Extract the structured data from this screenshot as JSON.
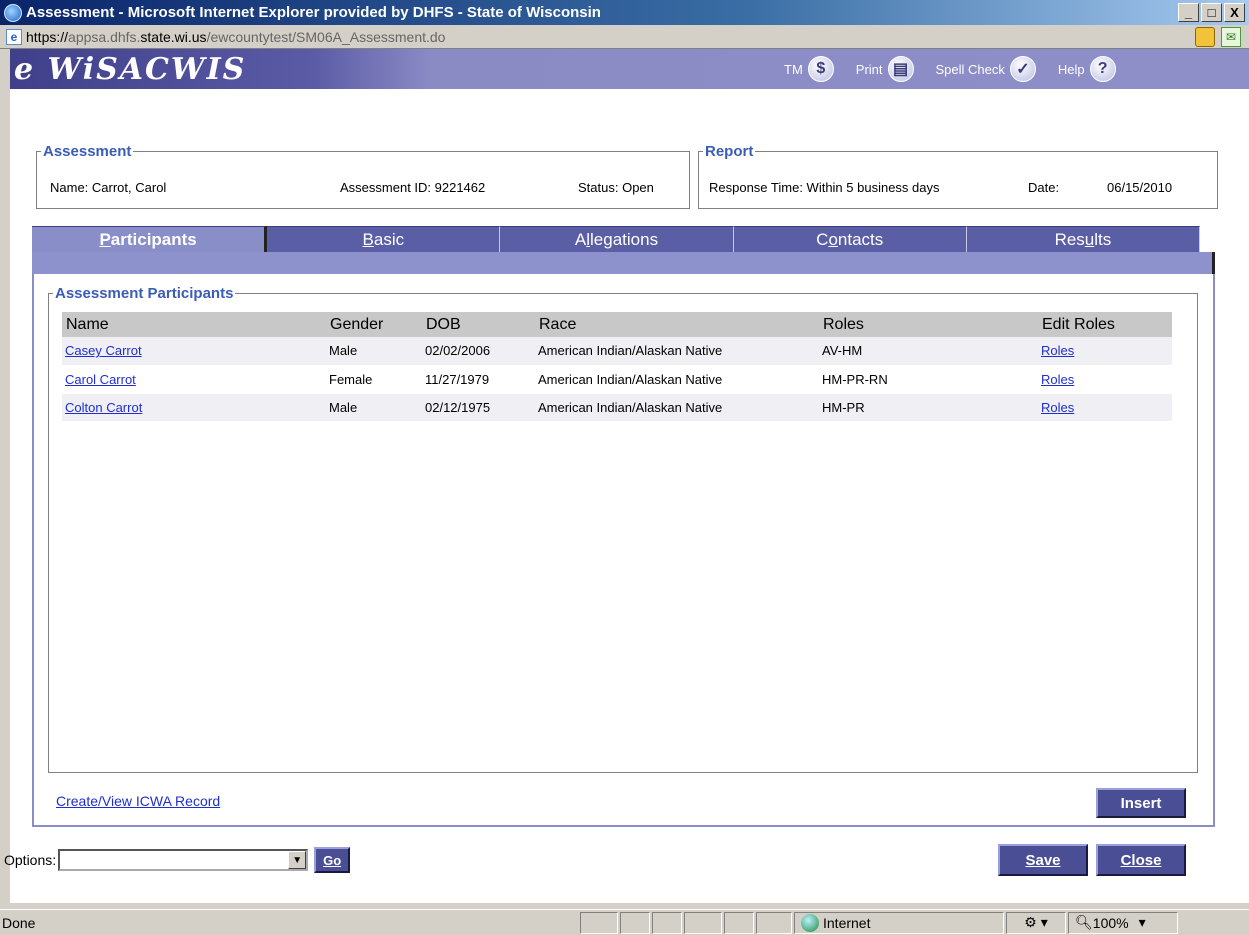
{
  "window": {
    "title": "Assessment - Microsoft Internet Explorer provided by DHFS - State of Wisconsin",
    "minimize": "_",
    "maximize": "□",
    "close": "X"
  },
  "address": {
    "url_scheme": "https://",
    "url_sub": "appsa.dhfs.",
    "url_host": "state.wi.us",
    "url_path": "/ewcountytest/SM06A_Assessment.do"
  },
  "app": {
    "brand": "e WiSACWIS",
    "tools": [
      {
        "label": "TM",
        "icon": "tm-globe-icon",
        "glyph": "$"
      },
      {
        "label": "Print",
        "icon": "print-icon",
        "glyph": "▤"
      },
      {
        "label": "Spell Check",
        "icon": "spell-check-icon",
        "glyph": "✓"
      },
      {
        "label": "Help",
        "icon": "help-icon",
        "glyph": "?"
      }
    ]
  },
  "assessment": {
    "legend": "Assessment",
    "name": "Name: Carrot, Carol",
    "id": "Assessment ID: 9221462",
    "status": "Status:  Open"
  },
  "report": {
    "legend": "Report",
    "response_time": "Response Time:  Within 5 business days",
    "date_label": "Date:",
    "date_value": "06/15/2010"
  },
  "tabs": [
    {
      "first": "P",
      "rest": "articipants",
      "active": true
    },
    {
      "first": "B",
      "rest": "asic",
      "active": false
    },
    {
      "pre": "A",
      "first": "l",
      "rest": "legations",
      "active": false
    },
    {
      "pre": "C",
      "first": "o",
      "rest": "ntacts",
      "active": false
    },
    {
      "pre": "Res",
      "first": "u",
      "rest": "lts",
      "active": false
    }
  ],
  "participants": {
    "legend": "Assessment Participants",
    "columns": [
      "Name",
      "Gender",
      "DOB",
      "Race",
      "Roles",
      "Edit Roles"
    ],
    "rows": [
      {
        "name": "Casey Carrot",
        "gender": "Male",
        "dob": "02/02/2006",
        "race": "American Indian/Alaskan Native",
        "roles": "AV-HM",
        "edit": "Roles"
      },
      {
        "name": "Carol Carrot",
        "gender": "Female",
        "dob": "11/27/1979",
        "race": "American Indian/Alaskan Native",
        "roles": "HM-PR-RN",
        "edit": "Roles"
      },
      {
        "name": "Colton Carrot",
        "gender": "Male",
        "dob": "02/12/1975",
        "race": "American Indian/Alaskan Native",
        "roles": "HM-PR",
        "edit": "Roles"
      }
    ]
  },
  "links": {
    "icwa": "Create/View ICWA Record"
  },
  "buttons": {
    "insert": "Insert",
    "go": "Go",
    "save": "Save",
    "close": "Close"
  },
  "options": {
    "label": "Options:",
    "value": ""
  },
  "status": {
    "text": "Done",
    "zone": "Internet",
    "zoom": "100%"
  }
}
